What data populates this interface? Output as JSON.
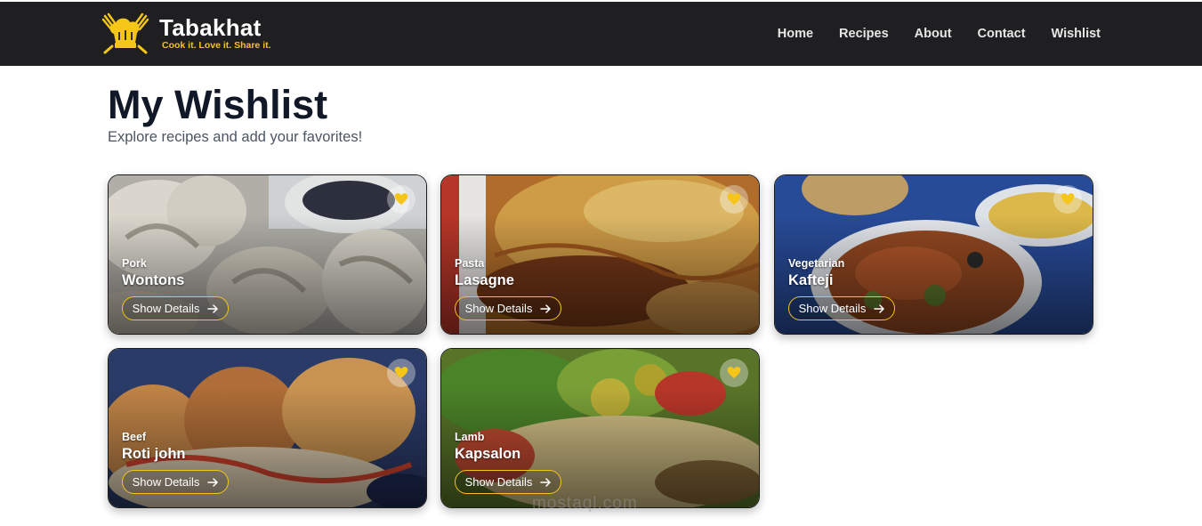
{
  "navbar": {
    "brand_name": "Tabakhat",
    "brand_tagline": "Cook it. Love it. Share it.",
    "links": [
      "Home",
      "Recipes",
      "About",
      "Contact",
      "Wishlist"
    ]
  },
  "page": {
    "title": "My Wishlist",
    "subtitle": "Explore recipes and add your favorites!"
  },
  "cards": [
    {
      "category": "Pork",
      "name": "Wontons",
      "button": "Show Details"
    },
    {
      "category": "Pasta",
      "name": "Lasagne",
      "button": "Show Details"
    },
    {
      "category": "Vegetarian",
      "name": "Kafteji",
      "button": "Show Details"
    },
    {
      "category": "Beef",
      "name": "Roti john",
      "button": "Show Details"
    },
    {
      "category": "Lamb",
      "name": "Kapsalon",
      "button": "Show Details"
    }
  ],
  "watermark": {
    "text": "mostaql.com"
  },
  "colors": {
    "navbar": "#1f1f21",
    "accent": "#f5c518",
    "title": "#111827"
  },
  "icons": {
    "logo": "chef-hat-utensils-icon",
    "favorite": "heart-icon",
    "button": "arrow-right-icon"
  }
}
